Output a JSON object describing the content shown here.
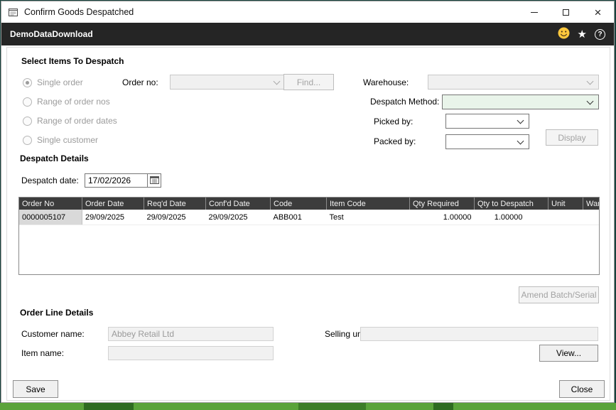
{
  "window": {
    "title": "Confirm Goods Despatched",
    "app_bar": {
      "title": "DemoDataDownload"
    }
  },
  "select_items": {
    "heading": "Select Items To Despatch",
    "radios": [
      {
        "label": "Single order",
        "selected": true
      },
      {
        "label": "Range of order nos",
        "selected": false
      },
      {
        "label": "Range of order dates",
        "selected": false
      },
      {
        "label": "Single customer",
        "selected": false
      }
    ],
    "order_no_label": "Order no:",
    "order_no_value": "",
    "find_button": "Find...",
    "warehouse_label": "Warehouse:",
    "warehouse_value": "",
    "despatch_method_label": "Despatch Method:",
    "despatch_method_value": "",
    "picked_by_label": "Picked by:",
    "picked_by_value": "",
    "packed_by_label": "Packed by:",
    "packed_by_value": "",
    "display_button": "Display"
  },
  "despatch_details": {
    "heading": "Despatch Details",
    "despatch_date_label": "Despatch date:",
    "despatch_date_value": "17/02/2026",
    "table": {
      "columns": [
        "Order No",
        "Order Date",
        "Req'd Date",
        "Conf'd Date",
        "Code",
        "Item Code",
        "Qty Required",
        "Qty to Despatch",
        "Unit",
        "Warehouse"
      ],
      "rows": [
        [
          "0000005107",
          "29/09/2025",
          "29/09/2025",
          "29/09/2025",
          "ABB001",
          "Test",
          "1.00000",
          "1.00000",
          "",
          ""
        ]
      ]
    },
    "amend_button": "Amend Batch/Serial"
  },
  "order_line_details": {
    "heading": "Order Line Details",
    "customer_name_label": "Customer name:",
    "customer_name_value": "Abbey Retail Ltd",
    "selling_unit_label": "Selling unit:",
    "selling_unit_value": "",
    "item_name_label": "Item name:",
    "item_name_value": "",
    "view_button": "View..."
  },
  "footer": {
    "save_button": "Save",
    "close_button": "Close"
  },
  "icons": {
    "window_icon": "form-glyph",
    "minimize_icon": "minimize-bar",
    "maximize_icon": "maximize-box",
    "close_icon": "×",
    "smiley_icon": "yellow-smiley",
    "star_icon": "★",
    "help_icon": "?",
    "calendar_icon": "calendar-grid",
    "dropdown_chevron": "chevron-down"
  },
  "colors": {
    "app_bar_bg": "#252525",
    "grid_header_bg": "#3c3c3c",
    "despatch_method_bg": "#e9f4ea",
    "smiley_yellow": "#ffc83d"
  }
}
